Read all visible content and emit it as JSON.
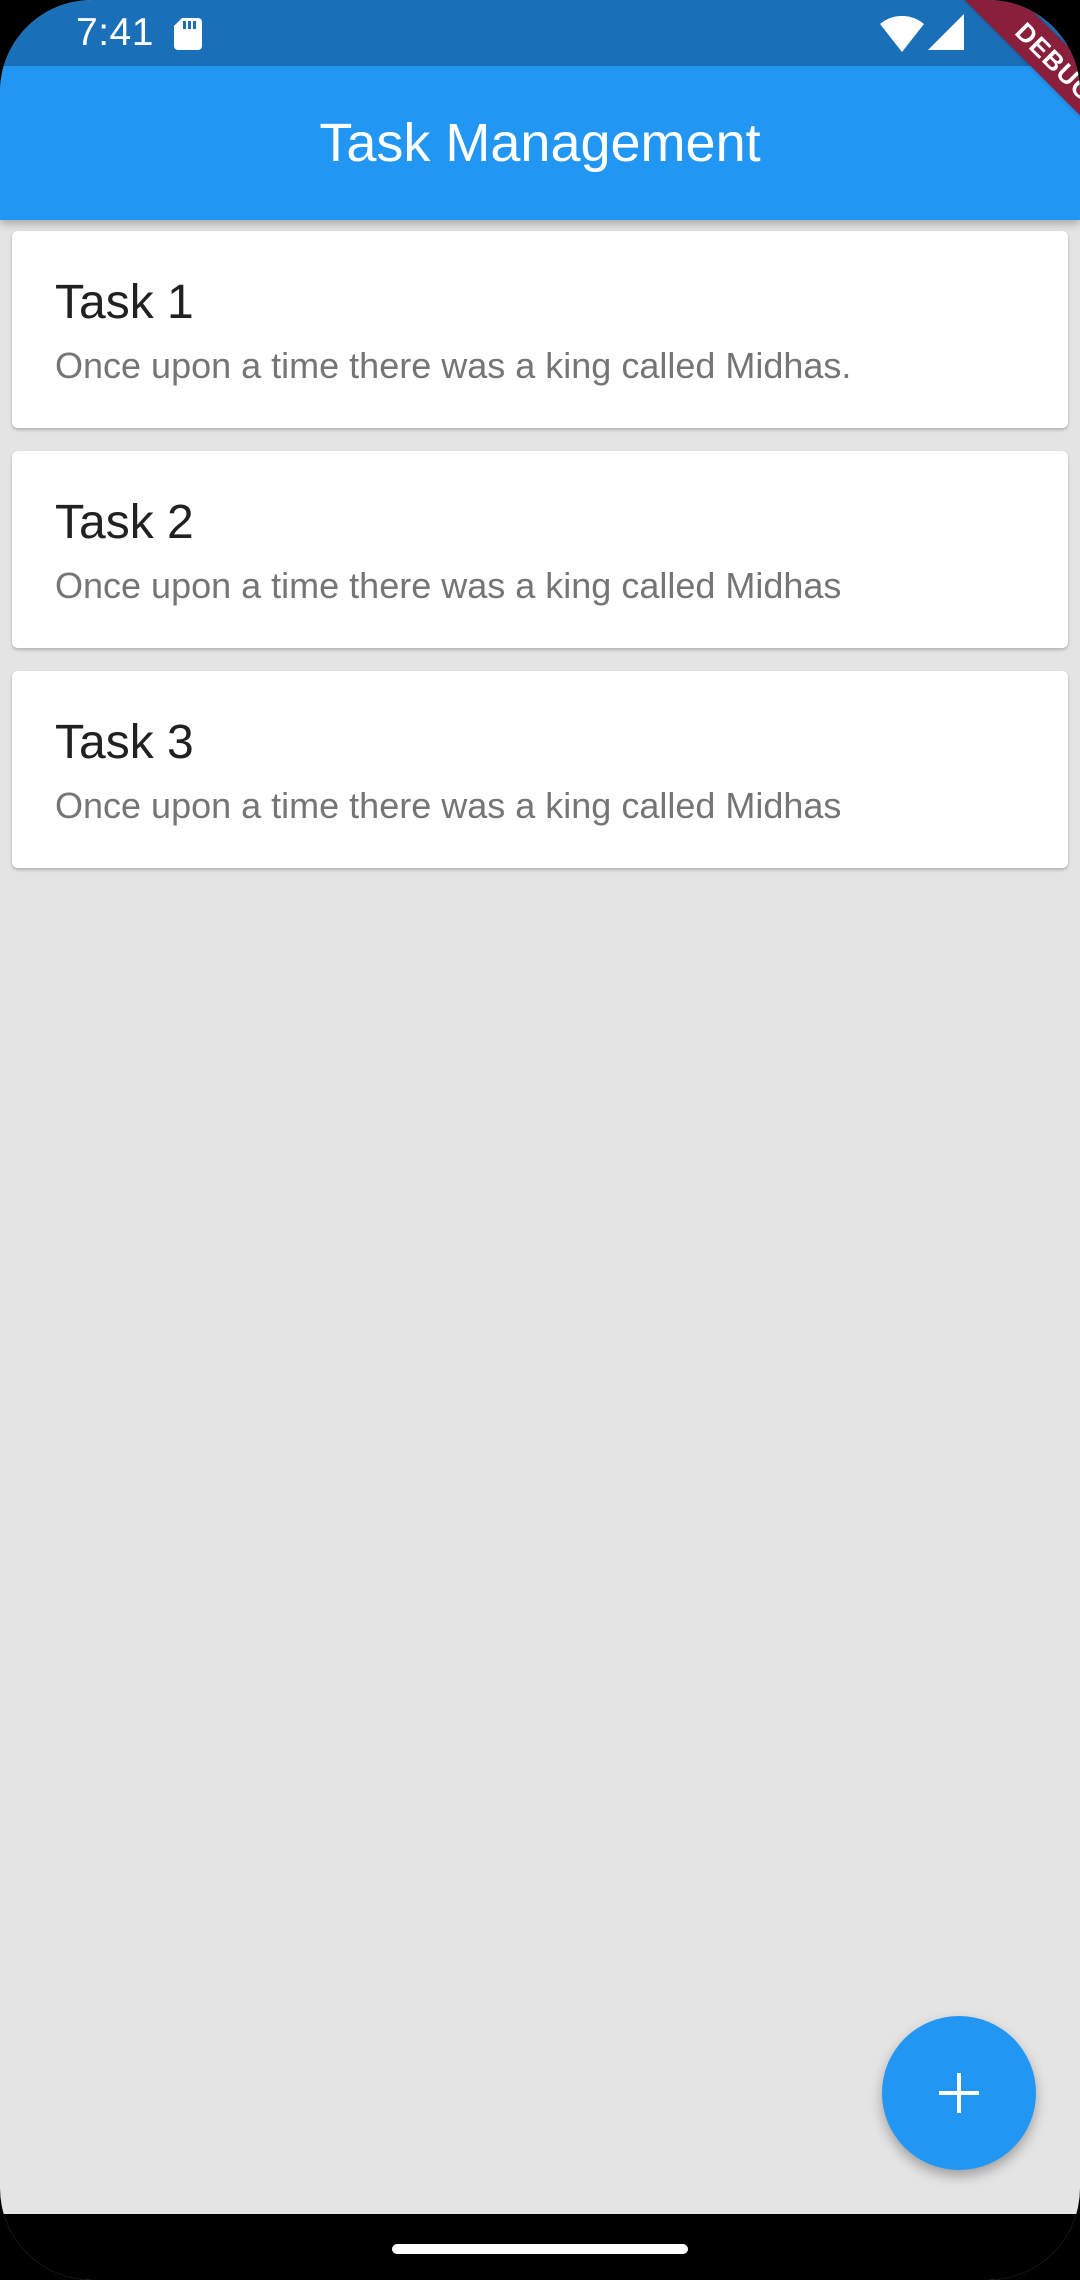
{
  "status_bar": {
    "time": "7:41",
    "icons": [
      "sd-card-icon",
      "wifi-icon",
      "signal-icon"
    ]
  },
  "app_bar": {
    "title": "Task Management",
    "color": "#2196f3"
  },
  "debug_banner": {
    "label": "DEBUG",
    "color": "#8a1f3c"
  },
  "tasks": [
    {
      "title": "Task 1",
      "description": "Once upon a time there was a king called Midhas."
    },
    {
      "title": "Task 2",
      "description": "Once upon a time there was a king called Midhas"
    },
    {
      "title": "Task 3",
      "description": "Once upon a time there was a king called Midhas"
    }
  ],
  "fab": {
    "icon": "plus-icon",
    "color": "#2196f3"
  },
  "colors": {
    "background": "#e4e4e4",
    "status_bar": "#1a70b8",
    "title_text": "#212121",
    "description_text": "#757575"
  }
}
